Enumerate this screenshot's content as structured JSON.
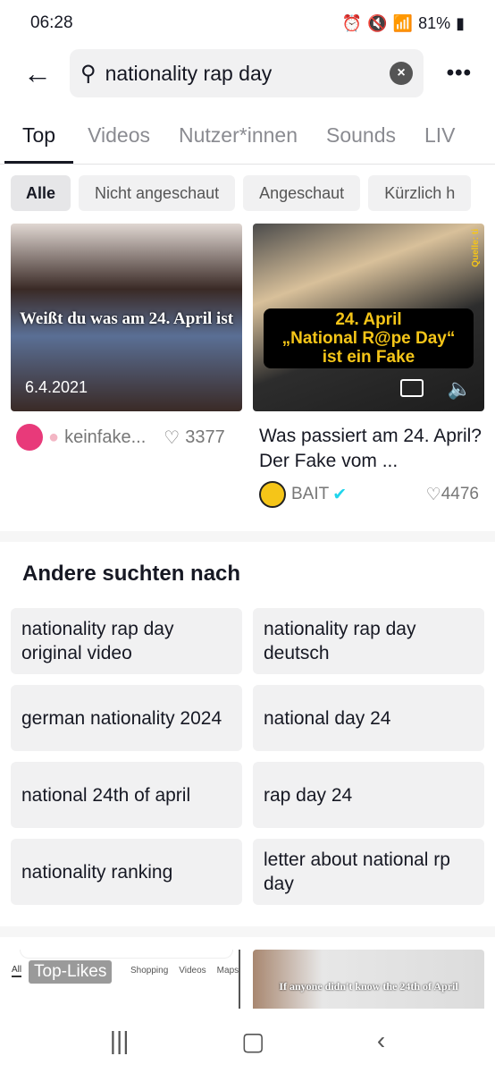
{
  "status": {
    "time": "06:28",
    "battery": "81%"
  },
  "search": {
    "query": "nationality rap day"
  },
  "tabs": [
    "Top",
    "Videos",
    "Nutzer*innen",
    "Sounds",
    "LIV"
  ],
  "filters": [
    "Alle",
    "Nicht angeschaut",
    "Angeschaut",
    "Kürzlich h"
  ],
  "videos": [
    {
      "caption": "Weißt du was am 24. April ist",
      "date": "6.4.2021",
      "author": "keinfake...",
      "likes": "3377"
    },
    {
      "caption_line1": "24. April",
      "caption_line2": "„National R@pe Day“",
      "caption_line3": "ist ein Fake",
      "source": "Quelle: ti",
      "title": "Was passiert am 24. April? Der Fake vom ...",
      "author": "BAIT",
      "likes": "4476"
    }
  ],
  "related": {
    "title": "Andere suchten nach",
    "items": [
      "nationality rap day original video",
      "nationality rap day deutsch",
      "german nationality 2024",
      "national day 24",
      "national 24th of april",
      "rap day 24",
      "nationality ranking",
      "letter about national rp day"
    ]
  },
  "bottom_videos": [
    {
      "label": "Top-Likes",
      "tabs": [
        "All",
        "Shopping",
        "Videos",
        "Maps"
      ]
    },
    {
      "caption": "If anyone didn't know the 24th of April"
    }
  ],
  "colors": {
    "accent": "#161823",
    "verified": "#20d5ec",
    "caption_yellow": "#f5c518"
  }
}
